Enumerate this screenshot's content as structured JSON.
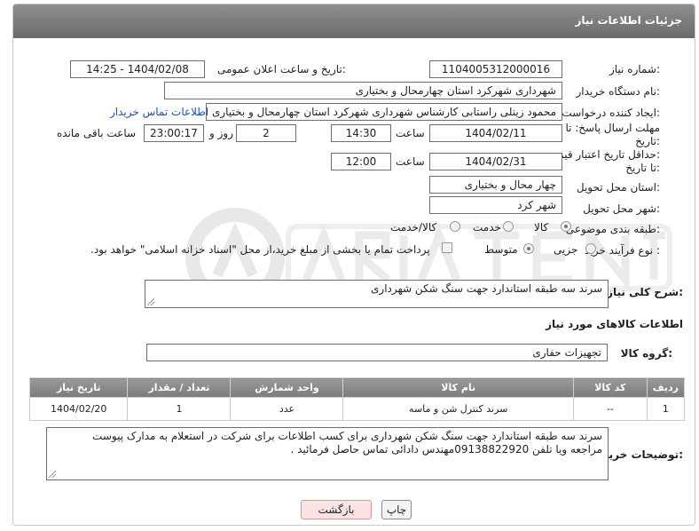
{
  "header": {
    "title": "جزئیات اطلاعات نیاز"
  },
  "fields": {
    "need_number": {
      "label": "شماره نیاز:",
      "value": "1104005312000016"
    },
    "announce_datetime": {
      "label": "تاریخ و ساعت اعلان عمومی:",
      "value": "1404/02/08 - 14:25"
    },
    "buyer_org": {
      "label": "نام دستگاه خریدار:",
      "value": "شهرداری شهرکرد استان چهارمحال و بختیاری"
    },
    "requester": {
      "label": "ایجاد کننده درخواست:",
      "value": "محمود زینلی راستابی کارشناس شهرداری شهرکرد استان چهارمحال و بختیاری",
      "contact_link": "اطلاعات تماس خریدار"
    },
    "response_deadline": {
      "label_line1": "مهلت ارسال پاسخ: تا",
      "label_line2": "تاریخ:",
      "date": "1404/02/11",
      "time_label": "ساعت",
      "time": "14:30",
      "days": "2",
      "days_label": "روز و",
      "remaining": "23:00:17",
      "remaining_label": "ساعت باقی مانده"
    },
    "price_validity": {
      "label_line1": "حداقل تاریخ اعتبار قیمت:",
      "label_line2": "تا تاریخ:",
      "date": "1404/02/31",
      "time_label": "ساعت",
      "time": "12:00"
    },
    "delivery_province": {
      "label": "استان محل تحویل:",
      "value": "چهار محال و بختیاری"
    },
    "delivery_city": {
      "label": "شهر محل تحویل:",
      "value": "شهر کرد"
    },
    "category": {
      "label": "طبقه بندی موضوعی:",
      "options": [
        "کالا",
        "خدمت",
        "کالا/خدمت"
      ],
      "selected": "کالا"
    },
    "purchase_process": {
      "label": "نوع فرآیند خرید :",
      "options": [
        "جزیی",
        "متوسط"
      ],
      "selected": "متوسط",
      "treasury_note": "پرداخت تمام یا بخشی از مبلغ خرید،از محل \"اسناد خزانه اسلامی\" خواهد بود."
    }
  },
  "need_description": {
    "label": "شرح کلی نیاز:",
    "value": "سرند سه طبقه استاندارد جهت سنگ شکن شهرداری"
  },
  "goods_section": {
    "title": "اطلاعات کالاهای مورد نیاز"
  },
  "goods_group": {
    "label": "گروه کالا:",
    "value": "تجهیزات حفاری"
  },
  "table": {
    "headers": [
      "ردیف",
      "کد کالا",
      "نام کالا",
      "واحد شمارش",
      "تعداد / مقدار",
      "تاریخ نیاز"
    ],
    "rows": [
      [
        "1",
        "--",
        "سرند کنترل شن و ماسه",
        "عدد",
        "1",
        "1404/02/20"
      ]
    ]
  },
  "buyer_notes": {
    "label": "توضیحات خریدار:",
    "line1": "سرند سه طبقه استاندارد جهت سنگ شکن شهرداری برای کسب اطلاعات برای شرکت در استعلام به مدارک پیوست",
    "line2": "مراجعه ویا تلفن 09138822920مهندس دادائی تماس حاصل فرمائید ."
  },
  "buttons": {
    "print": "چاپ",
    "back": "بازگشت"
  },
  "colors": {
    "header_bg": "#7c7c7c",
    "link": "#1a4fb5",
    "back_button": "#fde4e4"
  }
}
